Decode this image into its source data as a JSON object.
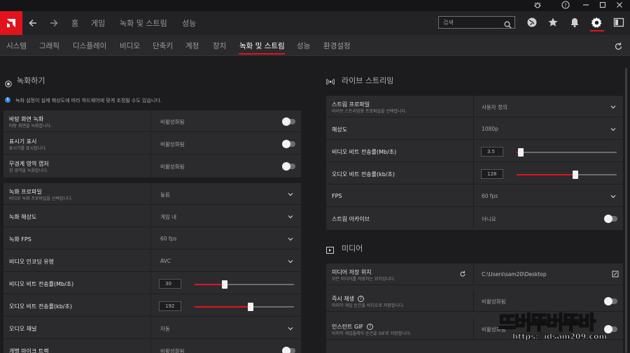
{
  "titlebar": {
    "controls": [
      "bug-icon",
      "help-icon",
      "minimize-icon",
      "maximize-icon",
      "close-icon"
    ]
  },
  "mainnav": {
    "items": [
      "홈",
      "게임",
      "녹화 및 스트림",
      "성능"
    ],
    "search_placeholder": "검색",
    "icons": [
      "globe-icon",
      "star-icon",
      "bell-icon",
      "gear-icon",
      "sidebar-icon"
    ],
    "accent": "#e1141e"
  },
  "subnav": {
    "items": [
      "시스템",
      "그래픽",
      "디스플레이",
      "비디오",
      "단축키",
      "계정",
      "장치",
      "녹화 및 스트림",
      "성능",
      "환경설정"
    ],
    "active": "녹화 및 스트림"
  },
  "left": {
    "section_title": "녹화하기",
    "info": "녹화 설정이 실제 해상도에 따라 하드웨어에 맞게 조정될 수도 있습니다.",
    "group1": [
      {
        "title": "바탕 화면 녹화",
        "sub": "바탕 화면을 녹화합니다.",
        "value": "비활성화됨",
        "toggle": false
      },
      {
        "title": "표시기 표시",
        "sub": "표시기를 표시합니다.",
        "value": "비활성화됨",
        "toggle": false
      },
      {
        "title": "무경계 영역 캡처",
        "sub": "창 영역을 녹화합니다.",
        "value": "비활성화됨",
        "toggle": false
      }
    ],
    "group2": [
      {
        "title": "녹화 프로파일",
        "sub": "비디오 녹화 프로파일을 선택합니다.",
        "value": "높음",
        "control": "dropdown"
      },
      {
        "title": "녹화 해상도",
        "sub": "",
        "value": "게임 내",
        "control": "dropdown"
      },
      {
        "title": "녹화 FPS",
        "sub": "",
        "value": "60 fps",
        "control": "dropdown"
      },
      {
        "title": "비디오 인코딩 유형",
        "sub": "",
        "value": "AVC",
        "control": "dropdown"
      },
      {
        "title": "비디오 비트 전송률(Mb/초)",
        "sub": "",
        "value": "30",
        "control": "slider",
        "level": 0.3
      },
      {
        "title": "오디오 비트 전송률(kb/초)",
        "sub": "",
        "value": "192",
        "control": "slider",
        "level": 0.56
      },
      {
        "title": "오디오 채널",
        "sub": "",
        "value": "자동",
        "control": "dropdown"
      },
      {
        "title": "개별 마이크 트랙",
        "sub": "",
        "value": "비활성화됨",
        "control": "toggle"
      }
    ]
  },
  "right": {
    "section_title": "라이브 스트리밍",
    "group1": [
      {
        "title": "스트림 프로파일",
        "sub": "라이브 스트리밍용 프로파일을 선택합니다.",
        "value": "사용자 정의",
        "control": "dropdown"
      },
      {
        "title": "해상도",
        "sub": "",
        "value": "1080p",
        "control": "dropdown"
      },
      {
        "title": "비디오 비트 전송률(Mb/초)",
        "sub": "",
        "value": "3.5",
        "control": "slider",
        "level": 0.04
      },
      {
        "title": "오디오 비트 전송률(kb/초)",
        "sub": "",
        "value": "128",
        "control": "slider",
        "level": 0.59
      },
      {
        "title": "FPS",
        "sub": "",
        "value": "60 fps",
        "control": "dropdown"
      },
      {
        "title": "스트림 아카이브",
        "sub": "",
        "value": "아니요",
        "control": "toggle"
      }
    ],
    "media_title": "미디어",
    "media": [
      {
        "title": "미디어 저장 위치",
        "sub": "모든 미디어를 저장하는 위치입니다.",
        "value": "C:\\Users\\sam20\\Desktop",
        "control": "path"
      },
      {
        "title": "즉시 재생",
        "sub": "마지막 게임 순간을 비디오로 저장합니다.",
        "value": "비활성화됨",
        "control": "toggle"
      },
      {
        "title": "인스턴트 GIF",
        "sub": "마지막 게임플레이 순간을 GIF로 저장합니다.",
        "value": "비활성화됨",
        "control": "toggle"
      }
    ]
  },
  "watermark": {
    "main": "뜨버뚜버뚜바",
    "url": "https://idsam209.com"
  }
}
